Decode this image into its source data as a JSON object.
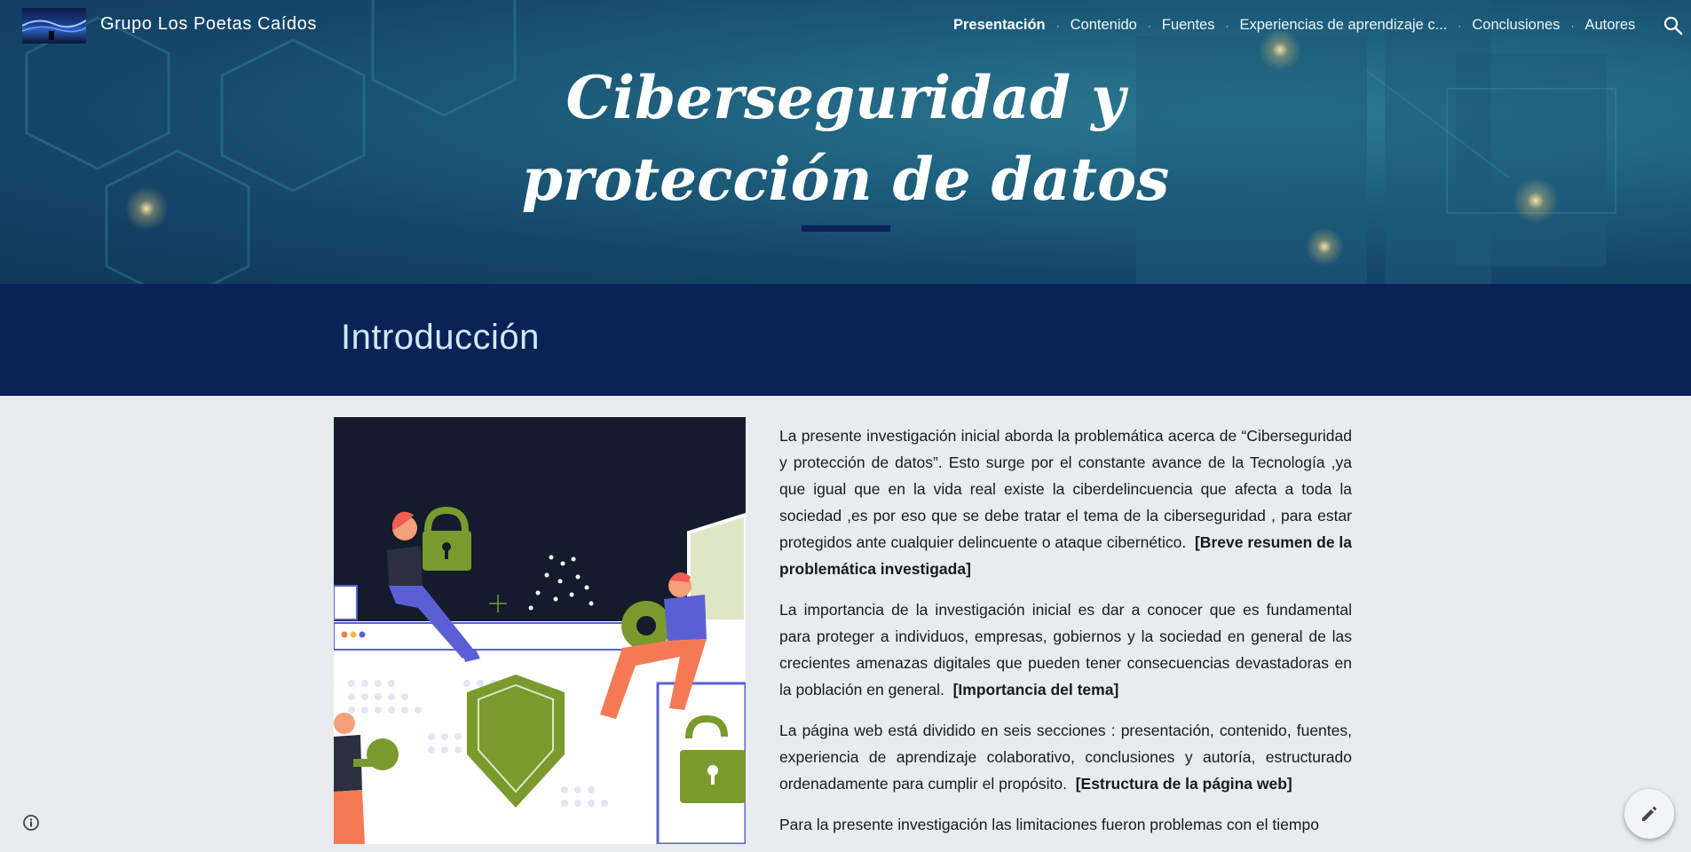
{
  "site": {
    "title": "Grupo Los Poetas Caídos"
  },
  "nav": {
    "items": [
      {
        "label": "Presentación",
        "active": true
      },
      {
        "label": "Contenido",
        "active": false
      },
      {
        "label": "Fuentes",
        "active": false
      },
      {
        "label": "Experiencias de aprendizaje c...",
        "active": false
      },
      {
        "label": "Conclusiones",
        "active": false
      },
      {
        "label": "Autores",
        "active": false
      }
    ],
    "separator": "·",
    "search_icon": "search-icon"
  },
  "hero": {
    "title_line1": "Ciberseguridad y",
    "title_line2": "protección de datos"
  },
  "section": {
    "heading": "Introducción"
  },
  "content": {
    "p1_text": "La presente investigación inicial aborda la problemática acerca de “Ciberseguridad y protección de datos”. Esto surge por el constante avance de la Tecnología ,ya que igual que en la vida real existe la ciberdelincuencia que afecta a toda la sociedad ,es por eso que se debe tratar el tema de la ciberseguridad , para estar protegidos ante cualquier delincuente o ataque cibernético.",
    "p1_bold": "[Breve resumen de la problemática investigada]",
    "p2_text": "La importancia de la investigación inicial es dar a conocer que es fundamental para proteger a individuos, empresas, gobiernos y la sociedad en general de las crecientes amenazas digitales que pueden tener consecuencias devastadoras en la población en general.",
    "p2_bold": "[Importancia del tema]",
    "p3_text": "La página web está dividido en seis secciones : presentación, contenido, fuentes, experiencia de aprendizaje colaborativo, conclusiones y autoría, estructurado ordenadamente para cumplir el propósito.",
    "p3_bold": "[Estructura de la página web]",
    "p4_text": "Para la presente investigación las limitaciones fueron problemas con el tiempo"
  },
  "colors": {
    "band": "#0a2256",
    "page_bg": "#e8ebef",
    "accent_green": "#7a9a2e",
    "heading_text": "#cfeaf5"
  }
}
